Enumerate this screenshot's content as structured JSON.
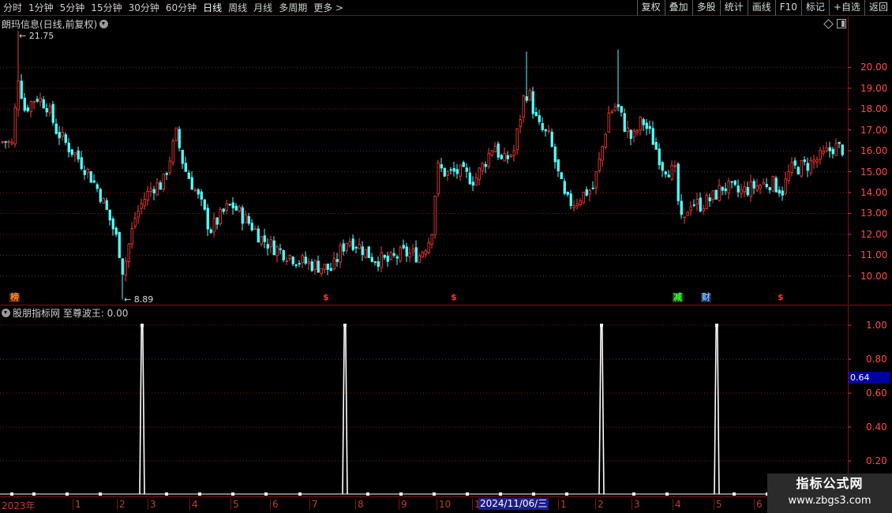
{
  "toolbar": {
    "period_tabs": [
      "分时",
      "1分钟",
      "5分钟",
      "15分钟",
      "30分钟",
      "60分钟",
      "日线",
      "周线",
      "月线",
      "多周期",
      "更多 >"
    ],
    "active_tab": "日线",
    "right_tools": [
      "复权",
      "叠加",
      "多股",
      "统计",
      "画线",
      "F10",
      "标记",
      "+自选",
      "返回"
    ]
  },
  "main": {
    "title": "朗玛信息(日线,前复权)",
    "high_label": "21.75",
    "low_label": "8.89",
    "markers": [
      {
        "text": "榜",
        "color": "#ff8a30",
        "bg": "#5a2000"
      },
      {
        "text": "$",
        "color": "#ff3030",
        "bg": ""
      },
      {
        "text": "$",
        "color": "#ff3030",
        "bg": ""
      },
      {
        "text": "减",
        "color": "#30ff30",
        "bg": "#1e4a1e"
      },
      {
        "text": "财",
        "color": "#70b8ff",
        "bg": "#1a2a4a"
      },
      {
        "text": "$",
        "color": "#ff3030",
        "bg": ""
      }
    ],
    "y_ticks": [
      "20.00",
      "19.00",
      "18.00",
      "17.00",
      "16.00",
      "15.00",
      "14.00",
      "13.00",
      "12.00",
      "11.00",
      "10.00"
    ]
  },
  "indicator": {
    "title": "股朋指标网 至尊波王: 0.00",
    "current_value": "0.64",
    "y_ticks": [
      "1.00",
      "0.80",
      "0.60",
      "0.40",
      "0.20"
    ]
  },
  "time_axis": {
    "labels": [
      "2023年",
      "1",
      "2",
      "3",
      "4",
      "5",
      "6",
      "7",
      "8",
      "9",
      "10",
      "1",
      "1",
      "2",
      "3",
      "4",
      "5",
      "6"
    ],
    "cursor_date": "2024/11/06/三"
  },
  "watermark": {
    "line1": "指标公式网",
    "line2": "www.zbgs3.com"
  },
  "colors": {
    "up": "#ff3b3b",
    "down": "#54ffff",
    "grid": "#8a1a1a",
    "axis": "#ff4040",
    "signal": "#ffffff"
  },
  "chart_data": {
    "type": "candlestick",
    "y_range": [
      9.2,
      21.9
    ],
    "price_path": [
      [
        0,
        16.4
      ],
      [
        4,
        16.5
      ],
      [
        14,
        16.3
      ],
      [
        22,
        19.6
      ],
      [
        30,
        18.0
      ],
      [
        45,
        18.6
      ],
      [
        58,
        18.2
      ],
      [
        70,
        17.0
      ],
      [
        85,
        16.2
      ],
      [
        95,
        15.8
      ],
      [
        110,
        15.0
      ],
      [
        125,
        14.0
      ],
      [
        135,
        13.0
      ],
      [
        145,
        12.0
      ],
      [
        150,
        11.2
      ],
      [
        155,
        10.1
      ],
      [
        160,
        11.2
      ],
      [
        170,
        12.8
      ],
      [
        180,
        13.6
      ],
      [
        192,
        14.3
      ],
      [
        205,
        14.4
      ],
      [
        215,
        15.8
      ],
      [
        222,
        16.8
      ],
      [
        232,
        15.2
      ],
      [
        245,
        14.2
      ],
      [
        255,
        13.3
      ],
      [
        265,
        12.2
      ],
      [
        275,
        12.7
      ],
      [
        285,
        13.2
      ],
      [
        293,
        13.4
      ],
      [
        305,
        12.9
      ],
      [
        318,
        12.4
      ],
      [
        330,
        11.8
      ],
      [
        345,
        11.4
      ],
      [
        360,
        11.1
      ],
      [
        380,
        10.7
      ],
      [
        400,
        10.5
      ],
      [
        420,
        10.3
      ],
      [
        430,
        11.2
      ],
      [
        440,
        11.8
      ],
      [
        455,
        11.4
      ],
      [
        470,
        10.9
      ],
      [
        490,
        10.7
      ],
      [
        510,
        11.1
      ],
      [
        530,
        11.0
      ],
      [
        545,
        11.9
      ],
      [
        553,
        15.2
      ],
      [
        565,
        14.9
      ],
      [
        580,
        15.0
      ],
      [
        600,
        14.6
      ],
      [
        615,
        15.6
      ],
      [
        625,
        16.4
      ],
      [
        635,
        15.4
      ],
      [
        650,
        16.0
      ],
      [
        662,
        18.5
      ],
      [
        668,
        18.9
      ],
      [
        680,
        17.2
      ],
      [
        695,
        16.6
      ],
      [
        705,
        15.0
      ],
      [
        715,
        13.6
      ],
      [
        725,
        13.5
      ],
      [
        740,
        14.0
      ],
      [
        750,
        14.2
      ],
      [
        760,
        15.8
      ],
      [
        770,
        17.8
      ],
      [
        780,
        18.2
      ],
      [
        790,
        17.2
      ],
      [
        800,
        16.5
      ],
      [
        812,
        17.5
      ],
      [
        825,
        16.6
      ],
      [
        838,
        15.3
      ],
      [
        855,
        14.9
      ],
      [
        860,
        12.7
      ],
      [
        865,
        12.4
      ],
      [
        872,
        13.6
      ],
      [
        885,
        13.4
      ],
      [
        900,
        13.7
      ],
      [
        915,
        14.3
      ],
      [
        935,
        14.0
      ],
      [
        955,
        14.3
      ],
      [
        975,
        14.5
      ],
      [
        990,
        14.1
      ],
      [
        1000,
        15.1
      ],
      [
        1020,
        15.3
      ],
      [
        1040,
        15.7
      ],
      [
        1055,
        16.2
      ],
      [
        1065,
        16.1
      ]
    ],
    "spikes": [
      {
        "x": 22,
        "y": 21.75
      },
      {
        "x": 155,
        "y": 8.89
      },
      {
        "x": 668,
        "y": 20.75
      },
      {
        "x": 782,
        "y": 20.85
      }
    ],
    "indicator_signal": {
      "y_range": [
        0,
        1.08
      ],
      "pulses": [
        180,
        437,
        762,
        908
      ],
      "baseline_dots": [
        15,
        43,
        85,
        127,
        211,
        253,
        295,
        337,
        380,
        466,
        508,
        550,
        592,
        634,
        676,
        718,
        803,
        845,
        930,
        972
      ]
    }
  }
}
